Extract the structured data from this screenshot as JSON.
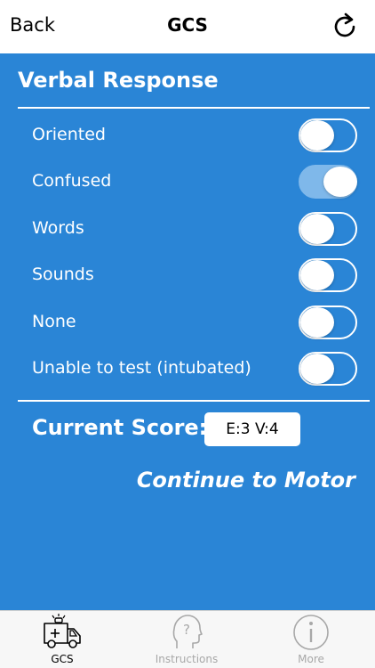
{
  "nav": {
    "back_label": "Back",
    "title": "GCS",
    "refresh_icon": "refresh-icon"
  },
  "section": {
    "title": "Verbal Response"
  },
  "options": [
    {
      "label": "Oriented",
      "on": false
    },
    {
      "label": "Confused",
      "on": true
    },
    {
      "label": "Words",
      "on": false
    },
    {
      "label": "Sounds",
      "on": false
    },
    {
      "label": "None",
      "on": false
    },
    {
      "label": "Unable to test (intubated)",
      "on": false
    }
  ],
  "score": {
    "label": "Current Score:",
    "value": "E:3 V:4"
  },
  "continue_label": "Continue to Motor",
  "tabs": [
    {
      "label": "GCS",
      "icon": "ambulance-icon",
      "active": true
    },
    {
      "label": "Instructions",
      "icon": "head-question-icon",
      "active": false
    },
    {
      "label": "More",
      "icon": "info-icon",
      "active": false
    }
  ],
  "colors": {
    "background": "#2a85d6",
    "toggle_on": "#7fb8ea",
    "tab_inactive": "#a8a8a8"
  }
}
